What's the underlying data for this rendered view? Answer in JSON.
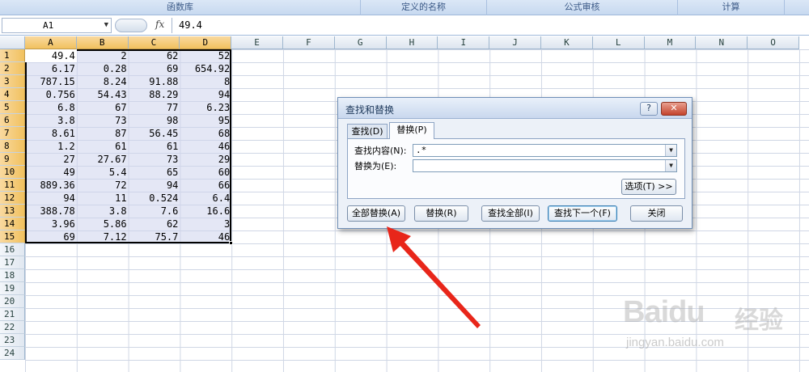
{
  "ribbon": {
    "groups": [
      "函数库",
      "定义的名称",
      "公式审核",
      "计算"
    ]
  },
  "formula_bar": {
    "name_box": "A1",
    "fx_symbol": "fx",
    "value": "49.4"
  },
  "sheet": {
    "columns": [
      "A",
      "B",
      "C",
      "D",
      "E",
      "F",
      "G",
      "H",
      "I",
      "J",
      "K",
      "L",
      "M",
      "N",
      "O"
    ],
    "rows": [
      "1",
      "2",
      "3",
      "4",
      "5",
      "6",
      "7",
      "8",
      "9",
      "10",
      "11",
      "12",
      "13",
      "14",
      "15",
      "16",
      "17",
      "18",
      "19",
      "20",
      "21",
      "22",
      "23",
      "24"
    ],
    "cells": [
      [
        "49.4",
        "2",
        "62",
        "52"
      ],
      [
        "6.17",
        "0.28",
        "69",
        "654.92"
      ],
      [
        "787.15",
        "8.24",
        "91.88",
        "8"
      ],
      [
        "0.756",
        "54.43",
        "88.29",
        "94"
      ],
      [
        "6.8",
        "67",
        "77",
        "6.23"
      ],
      [
        "3.8",
        "73",
        "98",
        "95"
      ],
      [
        "8.61",
        "87",
        "56.45",
        "68"
      ],
      [
        "1.2",
        "61",
        "61",
        "46"
      ],
      [
        "27",
        "27.67",
        "73",
        "29"
      ],
      [
        "49",
        "5.4",
        "65",
        "60"
      ],
      [
        "889.36",
        "72",
        "94",
        "66"
      ],
      [
        "94",
        "11",
        "0.524",
        "6.4"
      ],
      [
        "388.78",
        "3.8",
        "7.6",
        "16.6"
      ],
      [
        "3.96",
        "5.86",
        "62",
        "3"
      ],
      [
        "69",
        "7.12",
        "75.7",
        "46"
      ]
    ]
  },
  "dialog": {
    "title": "查找和替换",
    "help_button": "?",
    "close_button": "✕",
    "tabs": [
      "查找(D)",
      "替换(P)"
    ],
    "find_label": "查找内容(N):",
    "find_value": ".*",
    "replace_label": "替换为(E):",
    "replace_value": "",
    "options_button": "选项(T) >>",
    "buttons": {
      "replace_all": "全部替换(A)",
      "replace": "替换(R)",
      "find_all": "查找全部(I)",
      "find_next": "查找下一个(F)",
      "close": "关闭"
    }
  },
  "colors": {
    "selection_fill": "#cdd4ec",
    "arrow": "#e8261a",
    "header_selected": "#f1c15f"
  },
  "watermark": {
    "brand": "Baidu",
    "brand_cn": "经验",
    "url": "jingyan.baidu.com"
  }
}
